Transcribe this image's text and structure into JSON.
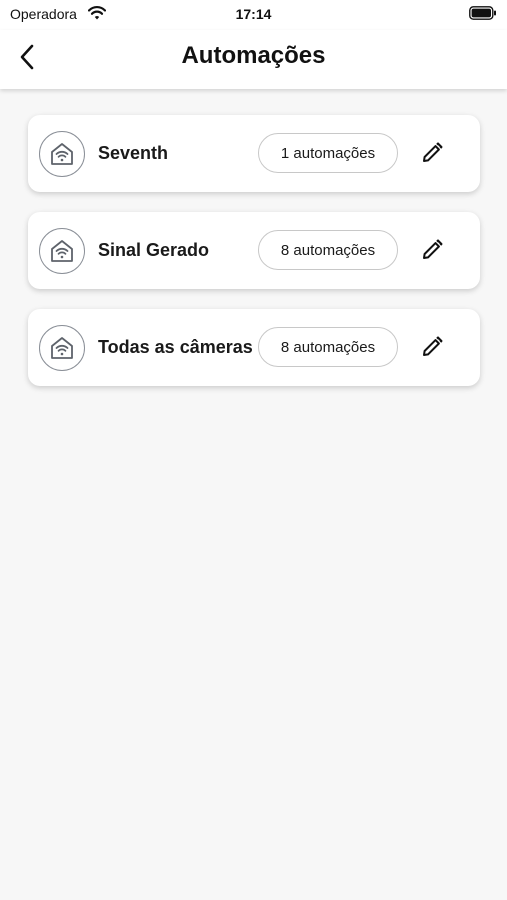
{
  "status_bar": {
    "carrier": "Operadora",
    "time": "17:14",
    "wifi_icon": "wifi-icon",
    "battery_icon": "battery-icon"
  },
  "header": {
    "title": "Automações",
    "back_icon": "chevron-left-icon"
  },
  "colors": {
    "background": "#f7f7f7",
    "card": "#ffffff",
    "icon_stroke": "#8a8f97",
    "text": "#1a1a1a"
  },
  "groups": [
    {
      "name": "Seventh",
      "count_label": "1 automações",
      "icon": "smart-home-icon",
      "edit_icon": "pencil-icon"
    },
    {
      "name": "Sinal Gerado",
      "count_label": "8 automações",
      "icon": "smart-home-icon",
      "edit_icon": "pencil-icon"
    },
    {
      "name": "Todas as câmeras",
      "count_label": "8 automações",
      "icon": "smart-home-icon",
      "edit_icon": "pencil-icon"
    }
  ]
}
